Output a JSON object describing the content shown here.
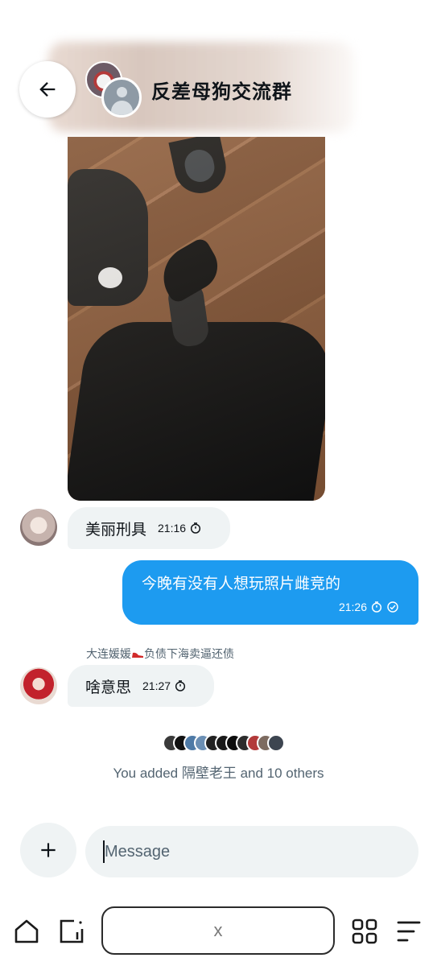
{
  "header": {
    "title": "反差母狗交流群",
    "back_icon": "arrow-left-icon"
  },
  "messages": [
    {
      "direction": "incoming",
      "text": "美丽刑具",
      "time": "21:16",
      "status_icon": "timer-icon"
    },
    {
      "direction": "outgoing",
      "text": "今晚有没有人想玩照片雌竞的",
      "time": "21:26",
      "status_icons": [
        "timer-icon",
        "check-circle-icon"
      ]
    },
    {
      "direction": "incoming",
      "sender_before": "大连媛媛",
      "sender_after": "负债下海卖逼还债",
      "text": "啥意思",
      "time": "21:27",
      "status_icon": "timer-icon"
    }
  ],
  "notice": {
    "text": "You added 隔壁老王 and 10 others",
    "avatar_colors": [
      "#3a3a3a",
      "#111111",
      "#4e7aa6",
      "#6b8fb4",
      "#222222",
      "#1a1a1a",
      "#0d0d0d",
      "#2c2c2c",
      "#b23a3a",
      "#7d6b60",
      "#3d4550"
    ]
  },
  "composer": {
    "placeholder": "Message",
    "add_icon": "plus-icon"
  },
  "browser": {
    "url_text": "x",
    "icons": [
      "home-icon",
      "tab-switch-icon",
      "apps-grid-icon",
      "menu-icon"
    ]
  }
}
